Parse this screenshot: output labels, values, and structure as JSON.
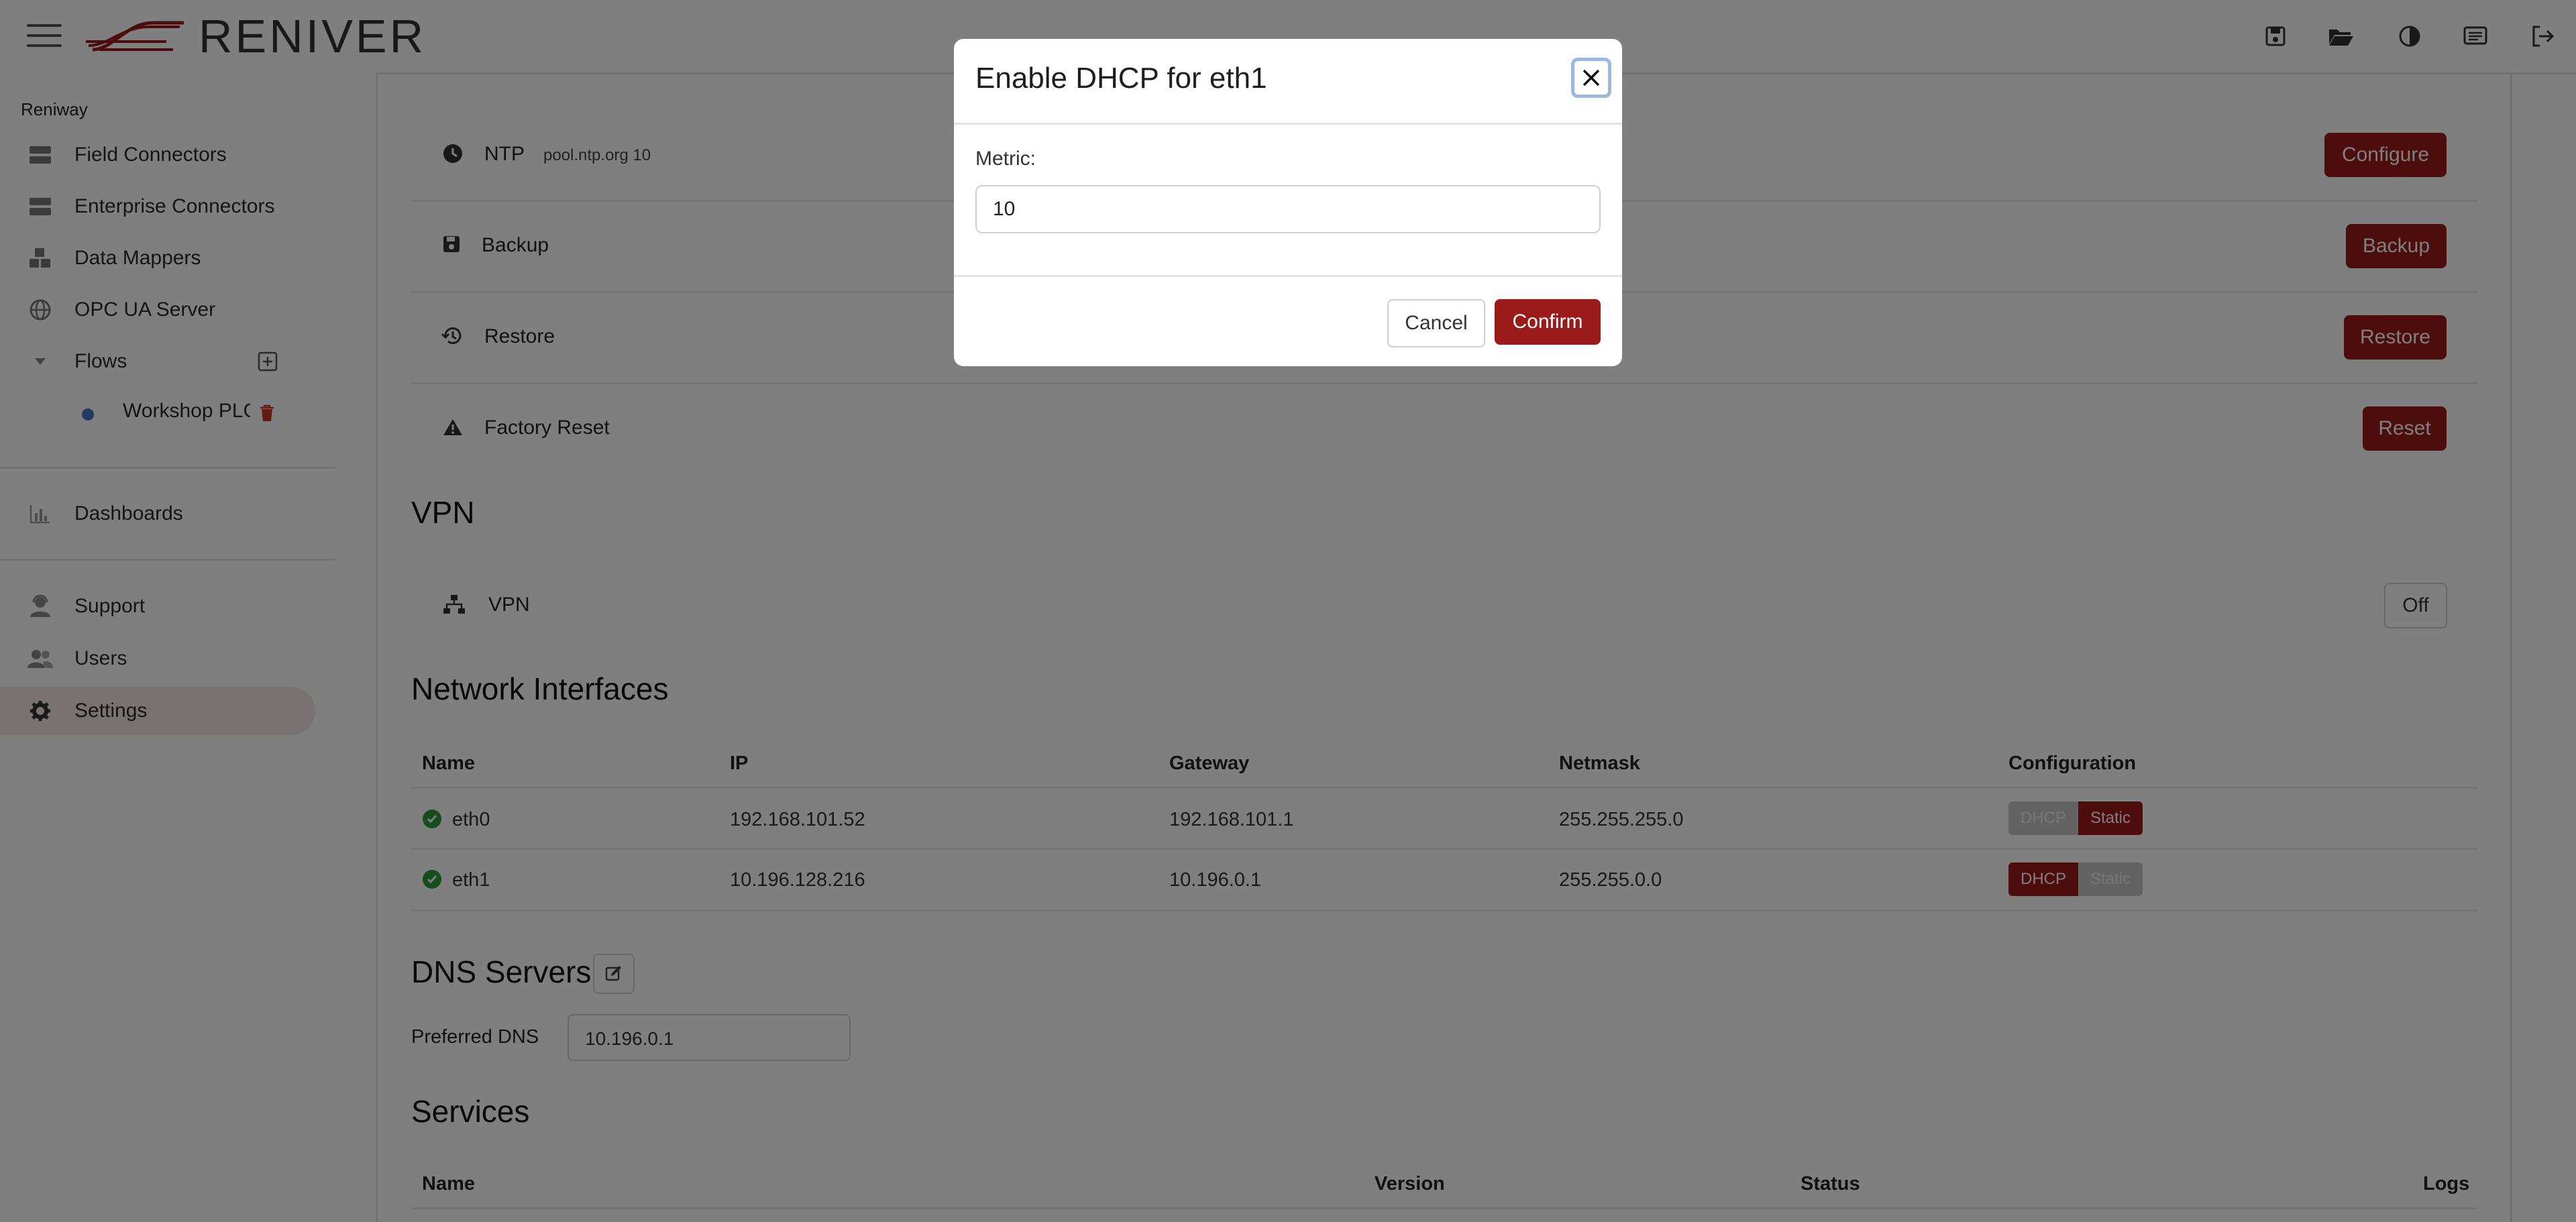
{
  "header": {
    "logo_text": "RENIVER",
    "icons": [
      "menu-icon",
      "save-icon",
      "folder-open-icon",
      "contrast-icon",
      "notes-icon",
      "logout-icon"
    ]
  },
  "sidebar": {
    "section_title": "Reniway",
    "items": [
      {
        "label": "Field Connectors",
        "icon": "server-icon"
      },
      {
        "label": "Enterprise Connectors",
        "icon": "server-icon"
      },
      {
        "label": "Data Mappers",
        "icon": "cubes-icon"
      },
      {
        "label": "OPC UA Server",
        "icon": "globe-icon"
      },
      {
        "label": "Flows",
        "icon": "caret-down-icon"
      },
      {
        "label": "Workshop PLC",
        "icon": "dot-icon"
      },
      {
        "label": "Dashboards",
        "icon": "chart-icon"
      },
      {
        "label": "Support",
        "icon": "support-icon"
      },
      {
        "label": "Users",
        "icon": "users-icon"
      },
      {
        "label": "Settings",
        "icon": "gear-icon"
      }
    ]
  },
  "settings_rows": [
    {
      "label": "NTP",
      "detail": "pool.ntp.org 10",
      "button": "Configure"
    },
    {
      "label": "Backup",
      "detail": "",
      "button": "Backup"
    },
    {
      "label": "Restore",
      "detail": "",
      "button": "Restore"
    },
    {
      "label": "Factory Reset",
      "detail": "",
      "button": "Reset"
    }
  ],
  "vpn": {
    "heading": "VPN",
    "label": "VPN",
    "toggle": "Off"
  },
  "network": {
    "heading": "Network Interfaces",
    "columns": [
      "Name",
      "IP",
      "Gateway",
      "Netmask",
      "Configuration"
    ],
    "rows": [
      {
        "name": "eth0",
        "ip": "192.168.101.52",
        "gateway": "192.168.101.1",
        "netmask": "255.255.255.0",
        "mode": "Static"
      },
      {
        "name": "eth1",
        "ip": "10.196.128.216",
        "gateway": "10.196.0.1",
        "netmask": "255.255.0.0",
        "mode": "DHCP"
      }
    ],
    "dhcp_label": "DHCP",
    "static_label": "Static"
  },
  "dns": {
    "heading": "DNS Servers",
    "preferred_label": "Preferred DNS",
    "preferred_value": "10.196.0.1"
  },
  "services": {
    "heading": "Services",
    "columns": [
      "Name",
      "Version",
      "Status",
      "Logs"
    ]
  },
  "modal": {
    "title": "Enable DHCP for eth1",
    "metric_label": "Metric:",
    "metric_value": "10",
    "cancel": "Cancel",
    "confirm": "Confirm"
  },
  "colors": {
    "accent": "#9b1a1a",
    "ok": "#2f9a3b",
    "active_bg": "#f3e5e4"
  }
}
